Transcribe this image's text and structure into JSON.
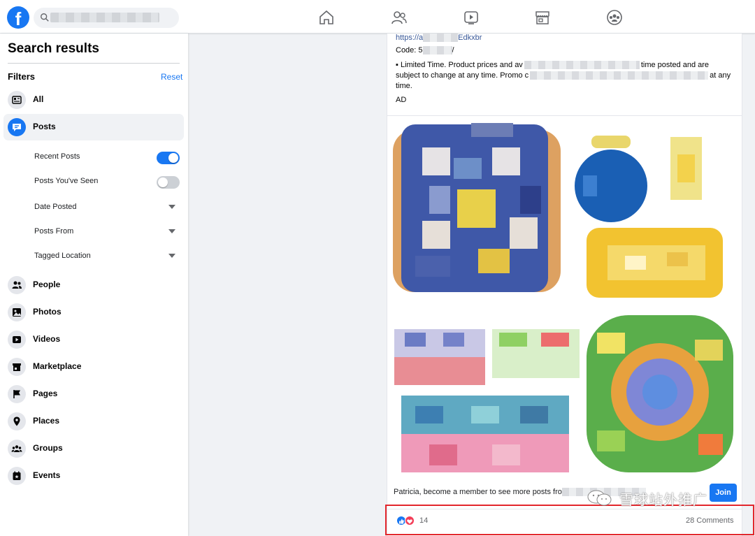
{
  "topbar": {
    "logo_letter": "f",
    "nav_icons": [
      "home-icon",
      "friends-icon",
      "watch-icon",
      "marketplace-icon",
      "groups-icon"
    ]
  },
  "sidebar": {
    "title": "Search results",
    "filters_label": "Filters",
    "reset_label": "Reset",
    "items": [
      {
        "label": "All",
        "icon": "all-icon"
      },
      {
        "label": "Posts",
        "icon": "posts-icon",
        "active": true
      },
      {
        "label": "People",
        "icon": "people-icon"
      },
      {
        "label": "Photos",
        "icon": "photos-icon"
      },
      {
        "label": "Videos",
        "icon": "videos-icon"
      },
      {
        "label": "Marketplace",
        "icon": "marketplace-icon"
      },
      {
        "label": "Pages",
        "icon": "pages-icon"
      },
      {
        "label": "Places",
        "icon": "places-icon"
      },
      {
        "label": "Groups",
        "icon": "groups-icon"
      },
      {
        "label": "Events",
        "icon": "events-icon"
      }
    ],
    "sub_filters": [
      {
        "label": "Recent Posts",
        "control": "toggle",
        "on": true
      },
      {
        "label": "Posts You've Seen",
        "control": "toggle",
        "on": false
      },
      {
        "label": "Date Posted",
        "control": "dropdown"
      },
      {
        "label": "Posts From",
        "control": "dropdown"
      },
      {
        "label": "Tagged Location",
        "control": "dropdown"
      }
    ]
  },
  "post": {
    "link_prefix": "https://a",
    "link_suffix": "Edkxbr",
    "code_prefix": "Code: 5",
    "code_suffix": "/",
    "body_start": "▪  Limited Time. Product prices and av",
    "body_mid1": "time posted and are",
    "body_line2_start": "subject to change at any time. Promo c",
    "body_line2_end": "at any",
    "body_line3": "time.",
    "ad_label": "AD",
    "member_text": "Patricia, become a member to see more posts fro",
    "join_label": "Join",
    "reaction_count": "14",
    "comments_label": "28 Comments"
  },
  "watermark": {
    "text": "雪球站外推广"
  },
  "colors": {
    "brand_blue": "#1877f2",
    "highlight_red": "#e2262c",
    "love_red": "#f33e58"
  }
}
